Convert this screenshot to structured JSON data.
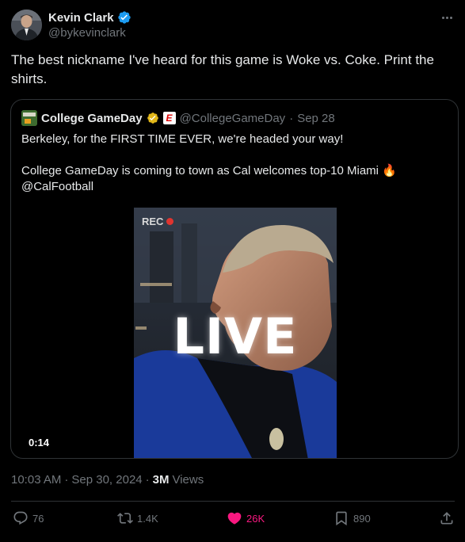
{
  "author": {
    "display_name": "Kevin Clark",
    "handle": "@bykevinclark",
    "verified": true
  },
  "tweet": {
    "text": "The best nickname I've heard for this game is Woke vs. Coke. Print the shirts.",
    "time": "10:03 AM",
    "separator": "·",
    "date": "Sep 30, 2024",
    "views_count": "3M",
    "views_label": "Views"
  },
  "quoted": {
    "display_name": "College GameDay",
    "handle": "@CollegeGameDay",
    "separator": "·",
    "date": "Sep 28",
    "espn_label": "E",
    "line1": "Berkeley, for the FIRST TIME EVER, we're headed your way!",
    "line2": "College GameDay is coming to town as Cal welcomes top-10 Miami 🔥",
    "line3": "@CalFootball",
    "video": {
      "rec_label": "REC",
      "overlay_text": "LIVE",
      "duration": "0:14"
    }
  },
  "actions": {
    "replies": "76",
    "reposts": "1.4K",
    "likes": "26K",
    "bookmarks": "890"
  },
  "colors": {
    "background": "#000000",
    "text": "#e7e9ea",
    "muted": "#71767b",
    "verified_blue": "#1d9bf0",
    "gold": "#e2b719",
    "like_pink": "#f91880",
    "border": "#2f3336"
  },
  "icons": [
    "verified-badge-icon",
    "more-icon",
    "gold-verified-icon",
    "espn-icon",
    "rec-dot-icon",
    "reply-icon",
    "repost-icon",
    "like-icon",
    "bookmark-icon",
    "share-icon"
  ]
}
